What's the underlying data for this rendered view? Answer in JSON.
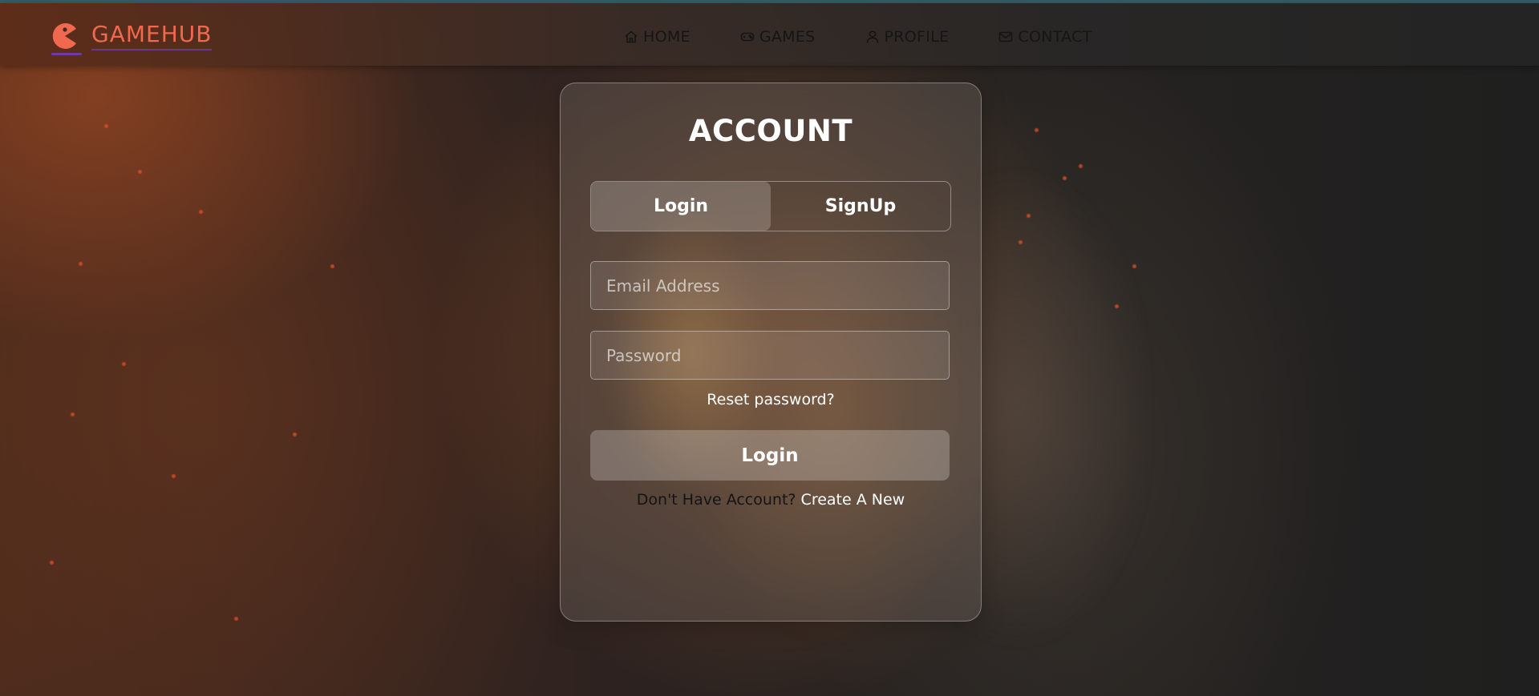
{
  "brand": {
    "name": "GAMEHUB",
    "logo_icon": "pacman-icon",
    "color": "#f0694e"
  },
  "nav": [
    {
      "label": "HOME",
      "icon": "home-icon"
    },
    {
      "label": "GAMES",
      "icon": "gamepad-icon"
    },
    {
      "label": "PROFILE",
      "icon": "user-icon"
    },
    {
      "label": "CONTACT",
      "icon": "mail-icon"
    }
  ],
  "account": {
    "title": "ACCOUNT",
    "tabs": [
      {
        "label": "Login",
        "active": true
      },
      {
        "label": "SignUp",
        "active": false
      }
    ],
    "email": {
      "placeholder": "Email Address",
      "value": ""
    },
    "password": {
      "placeholder": "Password",
      "value": ""
    },
    "reset_link": "Reset password?",
    "submit_label": "Login",
    "signup_prompt": "Don't Have Account?",
    "signup_link": "Create A New"
  }
}
